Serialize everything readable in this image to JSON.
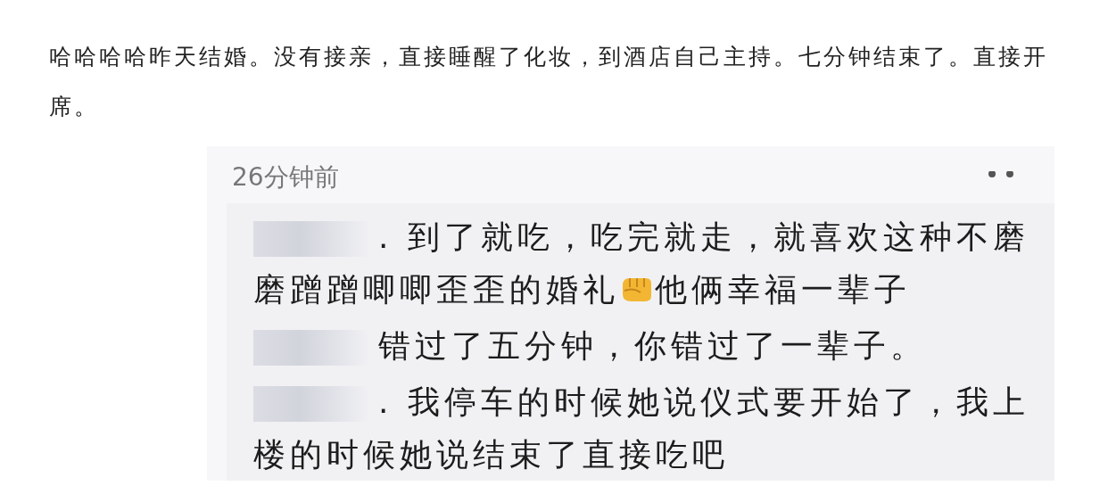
{
  "post": {
    "text": "哈哈哈哈昨天结婚。没有接亲，直接睡醒了化妆，到酒店自己主持。七分钟结束了。直接开席。"
  },
  "screenshot": {
    "time": "26分钟前",
    "comments": [
      {
        "parts": [
          {
            "kind": "text",
            "text": ". 到了就吃，吃完就走，就喜欢这种不磨磨蹭蹭唧唧歪歪的婚礼"
          },
          {
            "kind": "fist"
          },
          {
            "kind": "text",
            "text": "他俩幸福一辈子"
          }
        ]
      },
      {
        "parts": [
          {
            "kind": "text",
            "text": "错过了五分钟，你错过了一辈子。"
          }
        ]
      },
      {
        "parts": [
          {
            "kind": "text",
            "text": ". 我停车的时候她说仪式要开始了，我上楼的时候她说结束了直接吃吧"
          }
        ]
      }
    ]
  }
}
